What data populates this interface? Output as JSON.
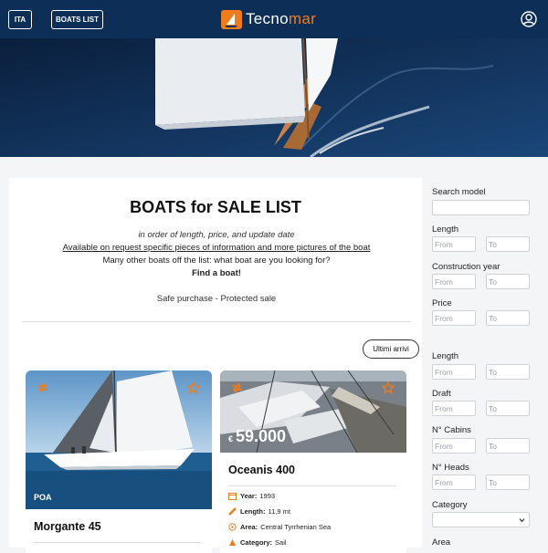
{
  "header": {
    "lang_button": "ITA",
    "boats_list_button": "BOATS LIST",
    "logo_text_main": "Tecno",
    "logo_text_accent": "mar",
    "brand_color": "#f07c1b",
    "bar_color": "#0d2f57"
  },
  "intro": {
    "title": "BOATS for SALE LIST",
    "subtitle": "in order of length, price, and update date",
    "request_link": "Available on request specific pieces of information and more pictures of the boat",
    "other_boats": "Many other boats off the list: what boat are you looking for?",
    "find_boat": "Find a boat!",
    "safe_purchase": "Safe purchase - Protected sale"
  },
  "sort_button": "Ultimi arrivi",
  "boats": [
    {
      "name": "Morgante 45",
      "badge": "POA",
      "icons": [
        "swap-icon",
        "star-outline-icon"
      ]
    },
    {
      "name": "Oceanis 400",
      "price_currency": "€",
      "price_value": "59.000",
      "icons": [
        "swap-icon",
        "star-outline-icon"
      ],
      "specs": [
        {
          "icon": "calendar-icon",
          "label": "Year:",
          "value": "1993"
        },
        {
          "icon": "ruler-icon",
          "label": "Length:",
          "value": "11,9 mt"
        },
        {
          "icon": "compass-icon",
          "label": "Area:",
          "value": "Central Tyrrhenian Sea"
        },
        {
          "icon": "category-icon",
          "label": "Category:",
          "value": "Sail"
        }
      ]
    }
  ],
  "filters": {
    "search_model_label": "Search model",
    "length_label": "Length",
    "construction_year_label": "Construction year",
    "price_label": "Price",
    "length2_label": "Length",
    "draft_label": "Draft",
    "cabins_label": "N° Cabins",
    "heads_label": "N° Heads",
    "category_label": "Category",
    "area_label": "Area",
    "from_placeholder": "From",
    "to_placeholder": "To"
  }
}
